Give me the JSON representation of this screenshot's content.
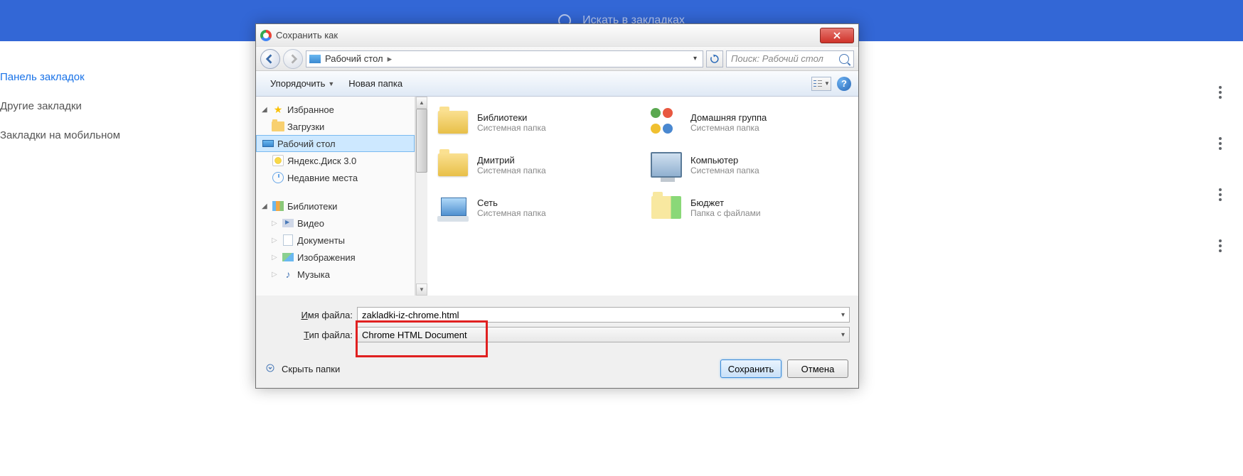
{
  "chrome": {
    "search_placeholder": "Искать в закладках",
    "sidebar": {
      "bookmarks_bar": "Панель закладок",
      "other": "Другие закладки",
      "mobile": "Закладки на мобильном"
    }
  },
  "dialog": {
    "title": "Сохранить как",
    "nav": {
      "breadcrumb": "Рабочий стол",
      "search_placeholder": "Поиск: Рабочий стол"
    },
    "toolbar": {
      "organize": "Упорядочить",
      "new_folder": "Новая папка"
    },
    "tree": {
      "favorites": "Избранное",
      "downloads": "Загрузки",
      "desktop": "Рабочий стол",
      "yadisk": "Яндекс.Диск 3.0",
      "recent": "Недавние места",
      "libraries": "Библиотеки",
      "videos": "Видео",
      "documents": "Документы",
      "images": "Изображения",
      "music": "Музыка"
    },
    "files": {
      "libraries": {
        "label": "Библиотеки",
        "sub": "Системная папка"
      },
      "homegroup": {
        "label": "Домашняя группа",
        "sub": "Системная папка"
      },
      "user": {
        "label": "Дмитрий",
        "sub": "Системная папка"
      },
      "computer": {
        "label": "Компьютер",
        "sub": "Системная папка"
      },
      "network": {
        "label": "Сеть",
        "sub": "Системная папка"
      },
      "budget": {
        "label": "Бюджет",
        "sub": "Папка с файлами"
      }
    },
    "form": {
      "filename_label": "Имя файла:",
      "filename_value": "zakladki-iz-chrome.html",
      "filetype_label": "Тип файла:",
      "filetype_value": "Chrome HTML Document"
    },
    "footer": {
      "hide_folders": "Скрыть папки",
      "save": "Сохранить",
      "cancel": "Отмена"
    }
  }
}
